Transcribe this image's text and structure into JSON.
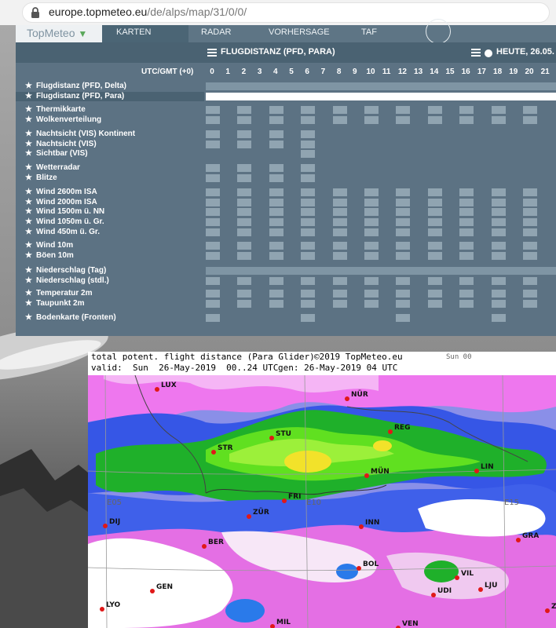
{
  "browser": {
    "url_host": "europe.topmeteo.eu",
    "url_path": "/de/alps/map/31/0/0/"
  },
  "nav": {
    "logo": "TopMeteo",
    "tabs": [
      {
        "label": "KARTEN",
        "active": true
      },
      {
        "label": "RADAR",
        "active": false
      },
      {
        "label": "VORHERSAGE",
        "active": false
      },
      {
        "label": "TAF",
        "active": false
      }
    ]
  },
  "panel": {
    "title": "FLUGDISTANZ (PFD, PARA)",
    "today": "HEUTE, 26.05.",
    "utc_label": "UTC/GMT (+0)",
    "hours": [
      "0",
      "1",
      "2",
      "3",
      "4",
      "5",
      "6",
      "7",
      "8",
      "9",
      "10",
      "11",
      "12",
      "13",
      "14",
      "15",
      "16",
      "17",
      "18",
      "19",
      "20",
      "21"
    ],
    "rows": [
      {
        "label": "Flugdistanz (PFD, Delta)",
        "type": "bar"
      },
      {
        "label": "Flugdistanz (PFD, Para)",
        "type": "bar",
        "selected": true
      },
      {
        "label": "Thermikkarte",
        "type": "cells",
        "cols": [
          0,
          2,
          4,
          6,
          8,
          10,
          12,
          14,
          16,
          18,
          20
        ]
      },
      {
        "label": "Wolkenverteilung",
        "type": "cells",
        "cols": [
          0,
          2,
          4,
          6,
          8,
          10,
          12,
          14,
          16,
          18,
          20
        ]
      },
      {
        "label": "Nachtsicht (VIS) Kontinent",
        "type": "cells",
        "cols": [
          0,
          2,
          4,
          6
        ]
      },
      {
        "label": "Nachtsicht (VIS)",
        "type": "cells",
        "cols": [
          0,
          2,
          4,
          6
        ]
      },
      {
        "label": "Sichtbar (VIS)",
        "type": "cells",
        "cols": [
          6
        ]
      },
      {
        "label": "Wetterradar",
        "type": "cells",
        "cols": [
          0,
          2,
          4,
          6
        ]
      },
      {
        "label": "Blitze",
        "type": "cells",
        "cols": [
          0,
          2,
          4,
          6
        ]
      },
      {
        "label": "Wind 2600m ISA",
        "type": "cells",
        "cols": [
          0,
          2,
          4,
          6,
          8,
          10,
          12,
          14,
          16,
          18,
          20
        ]
      },
      {
        "label": "Wind 2000m ISA",
        "type": "cells",
        "cols": [
          0,
          2,
          4,
          6,
          8,
          10,
          12,
          14,
          16,
          18,
          20
        ]
      },
      {
        "label": "Wind 1500m ü. NN",
        "type": "cells",
        "cols": [
          0,
          2,
          4,
          6,
          8,
          10,
          12,
          14,
          16,
          18,
          20
        ]
      },
      {
        "label": "Wind 1050m ü. Gr.",
        "type": "cells",
        "cols": [
          0,
          2,
          4,
          6,
          8,
          10,
          12,
          14,
          16,
          18,
          20
        ]
      },
      {
        "label": "Wind 450m ü. Gr.",
        "type": "cells",
        "cols": [
          0,
          2,
          4,
          6,
          8,
          10,
          12,
          14,
          16,
          18,
          20
        ]
      },
      {
        "label": "Wind 10m",
        "type": "cells",
        "cols": [
          0,
          2,
          4,
          6,
          8,
          10,
          12,
          14,
          16,
          18,
          20
        ]
      },
      {
        "label": "Böen 10m",
        "type": "cells",
        "cols": [
          0,
          2,
          4,
          6,
          8,
          10,
          12,
          14,
          16,
          18,
          20
        ]
      },
      {
        "label": "Niederschlag (Tag)",
        "type": "bar"
      },
      {
        "label": "Niederschlag (stdl.)",
        "type": "cells",
        "cols": [
          0,
          2,
          4,
          6,
          8,
          10,
          12,
          14,
          16,
          18,
          20
        ]
      },
      {
        "label": "Temperatur 2m",
        "type": "cells",
        "cols": [
          0,
          2,
          4,
          6,
          8,
          10,
          12,
          14,
          16,
          18,
          20
        ]
      },
      {
        "label": "Taupunkt 2m",
        "type": "cells",
        "cols": [
          0,
          2,
          4,
          6,
          8,
          10,
          12,
          14,
          16,
          18,
          20
        ]
      },
      {
        "label": "Bodenkarte (Fronten)",
        "type": "cells",
        "cols": [
          0,
          6,
          12,
          18
        ]
      }
    ]
  },
  "map": {
    "title": "total potent. flight distance (Para Glider)",
    "copyright": "©2019 TopMeteo.eu",
    "run": "Sun 00",
    "valid": "valid:  Sun  26-May-2019  00..24 UTC",
    "gen": "gen: 26-May-2019 04 UTC",
    "cities": [
      "LUX",
      "NÜR",
      "REG",
      "STR",
      "STU",
      "MÜN",
      "LIN",
      "FRI",
      "ZÜR",
      "DIJ",
      "INN",
      "GRA",
      "BER",
      "BOL",
      "VIL",
      "LJU",
      "GEN",
      "UDI",
      "LYO",
      "MIL",
      "VEN",
      "ZA"
    ],
    "grid_labels": [
      "E05",
      "E10",
      "E15"
    ]
  },
  "colors": {
    "panel": "#5c7283",
    "panel_header": "#4a6272",
    "cell": "#90a4b1",
    "accent": "#5aa85a"
  }
}
